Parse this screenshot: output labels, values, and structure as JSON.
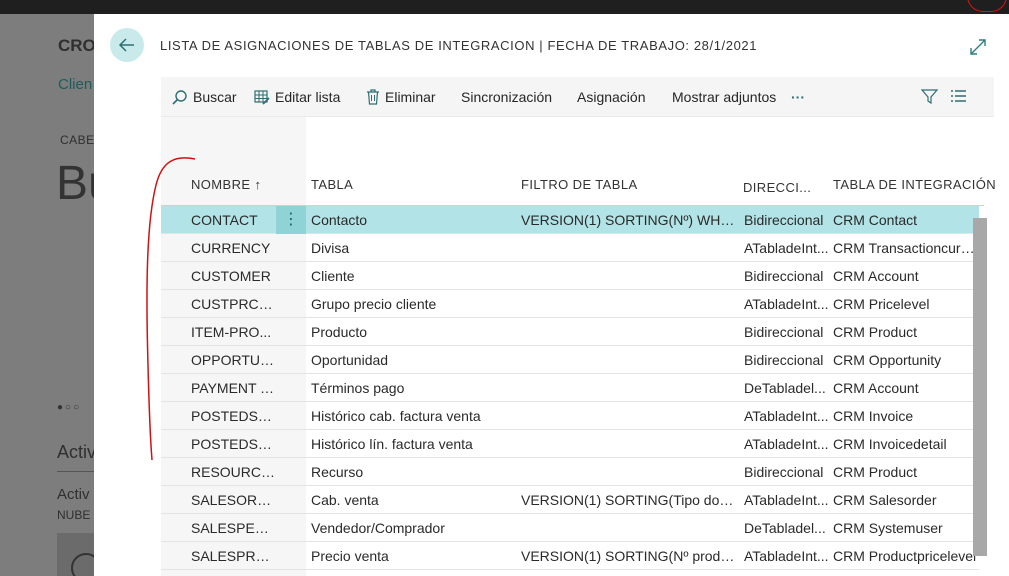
{
  "background": {
    "title": "CRO",
    "client_link": "Clien",
    "section": "CABE",
    "big_text": "Bu",
    "dots": "●○○",
    "activities": "Activ",
    "activities2": "Activ",
    "cloud": "NUBE"
  },
  "dialog": {
    "title": "LISTA DE ASIGNACIONES DE TABLAS DE INTEGRACION | FECHA DE TRABAJO: 28/1/2021",
    "back_icon": "arrow-left-icon",
    "expand_icon": "expand-icon"
  },
  "toolbar": {
    "search": "Buscar",
    "edit_list": "Editar lista",
    "delete": "Eliminar",
    "sync": "Sincronización",
    "assign": "Asignación",
    "attachments": "Mostrar adjuntos",
    "more": "···"
  },
  "columns": {
    "name": "NOMBRE ↑",
    "table": "TABLA",
    "filter": "FILTRO DE TABLA",
    "direction": "DIRECCI...",
    "integration": "TABLA DE INTEGRACIÓN"
  },
  "rows": [
    {
      "name": "CONTACT",
      "table": "Contacto",
      "filter": "VERSION(1) SORTING(Nº) WHER...",
      "direction": "Bidireccional",
      "integration": "CRM Contact"
    },
    {
      "name": "CURRENCY",
      "table": "Divisa",
      "filter": "",
      "direction": "ATabladeInt...",
      "integration": "CRM Transactioncurrency"
    },
    {
      "name": "CUSTOMER",
      "table": "Cliente",
      "filter": "",
      "direction": "Bidireccional",
      "integration": "CRM Account"
    },
    {
      "name": "CUSTPRCG...",
      "table": "Grupo precio cliente",
      "filter": "",
      "direction": "ATabladeInt...",
      "integration": "CRM Pricelevel"
    },
    {
      "name": "ITEM-PRO...",
      "table": "Producto",
      "filter": "",
      "direction": "Bidireccional",
      "integration": "CRM Product"
    },
    {
      "name": "OPPORTUN...",
      "table": "Oportunidad",
      "filter": "",
      "direction": "Bidireccional",
      "integration": "CRM Opportunity"
    },
    {
      "name": "PAYMENT T...",
      "table": "Términos pago",
      "filter": "",
      "direction": "DeTabladel...",
      "integration": "CRM Account"
    },
    {
      "name": "POSTEDSA...",
      "table": "Histórico cab. factura venta",
      "filter": "",
      "direction": "ATabladeInt...",
      "integration": "CRM Invoice"
    },
    {
      "name": "POSTEDSA...",
      "table": "Histórico lín. factura venta",
      "filter": "",
      "direction": "ATabladeInt...",
      "integration": "CRM Invoicedetail"
    },
    {
      "name": "RESOURCE-...",
      "table": "Recurso",
      "filter": "",
      "direction": "Bidireccional",
      "integration": "CRM Product"
    },
    {
      "name": "SALESORD...",
      "table": "Cab. venta",
      "filter": "VERSION(1) SORTING(Tipo docu...",
      "direction": "ATabladeInt...",
      "integration": "CRM Salesorder"
    },
    {
      "name": "SALESPEOP...",
      "table": "Vendedor/Comprador",
      "filter": "",
      "direction": "DeTabladel...",
      "integration": "CRM Systemuser"
    },
    {
      "name": "SALESPRC-...",
      "table": "Precio venta",
      "filter": "VERSION(1) SORTING(Nº produc...",
      "direction": "ATabladeInt...",
      "integration": "CRM Productpricelevel"
    }
  ],
  "row_menu": "⋮",
  "colors": {
    "accent": "#b2e3e6",
    "accent_dark": "#8fd3d6",
    "annotation": "#d11111"
  }
}
